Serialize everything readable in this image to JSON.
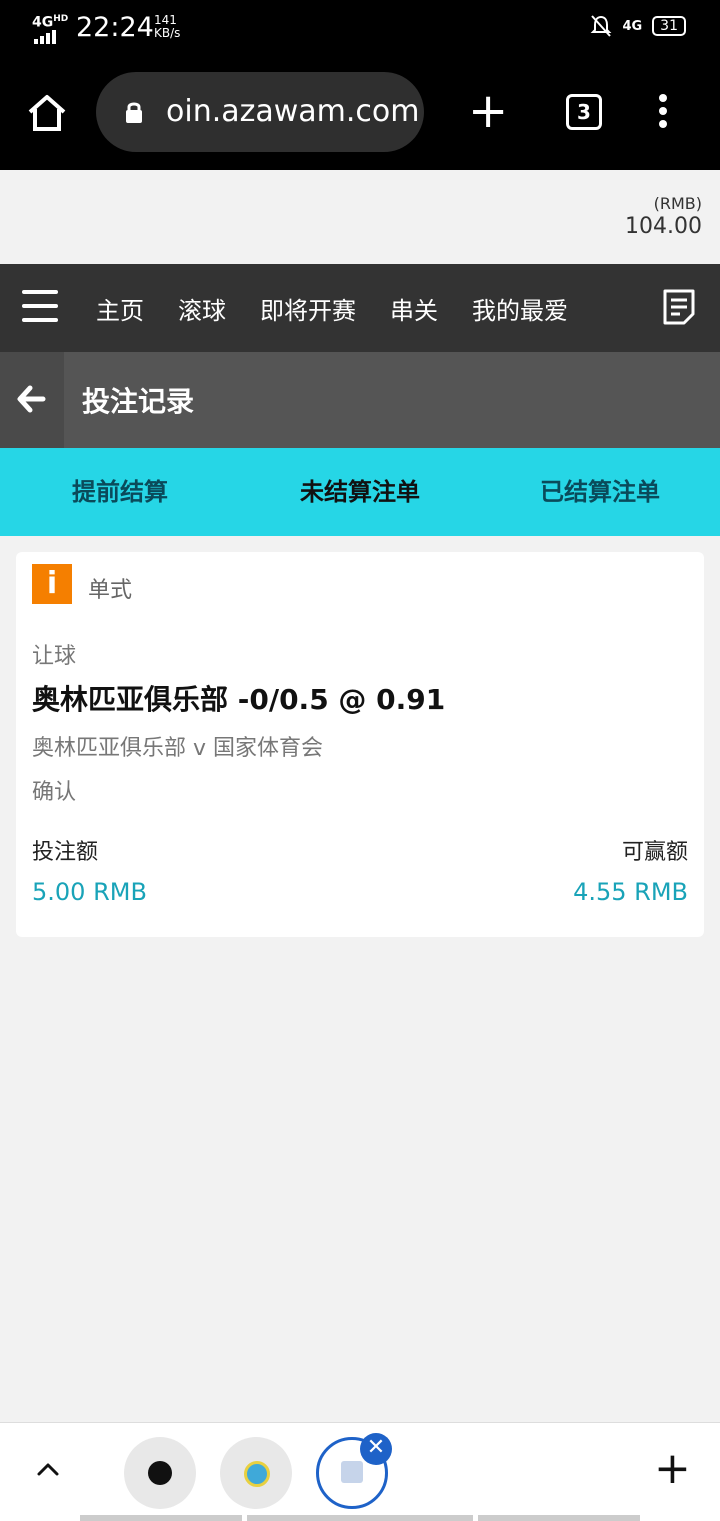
{
  "status_bar": {
    "network": "4G",
    "network_hd": "HD",
    "time": "22:24",
    "speed_value": "141",
    "speed_unit": "KB/s",
    "right_network": "4G",
    "battery": "31"
  },
  "browser": {
    "url": "oin.azawam.com",
    "tab_count": "3"
  },
  "balance": {
    "currency": "(RMB)",
    "amount": "104.00"
  },
  "nav": {
    "items": [
      "主页",
      "滚球",
      "即将开赛",
      "串关",
      "我的最爱"
    ]
  },
  "page": {
    "title": "投注记录"
  },
  "tabs": [
    {
      "label": "提前结算",
      "active": false
    },
    {
      "label": "未结算注单",
      "active": true
    },
    {
      "label": "已结算注单",
      "active": false
    }
  ],
  "bet": {
    "badge": "i",
    "type": "单式",
    "market": "让球",
    "selection": "奥林匹亚俱乐部 -0/0.5 @ 0.91",
    "match": "奥林匹亚俱乐部 v 国家体育会",
    "status": "确认",
    "stake_label": "投注额",
    "win_label": "可赢额",
    "stake_value": "5.00 RMB",
    "win_value": "4.55 RMB"
  },
  "colors": {
    "accent_cyan": "#26d6e6",
    "value_teal": "#19a3b8",
    "badge_orange": "#f57f00",
    "nav_dark": "#333333",
    "tab_close_blue": "#1e62c8"
  }
}
